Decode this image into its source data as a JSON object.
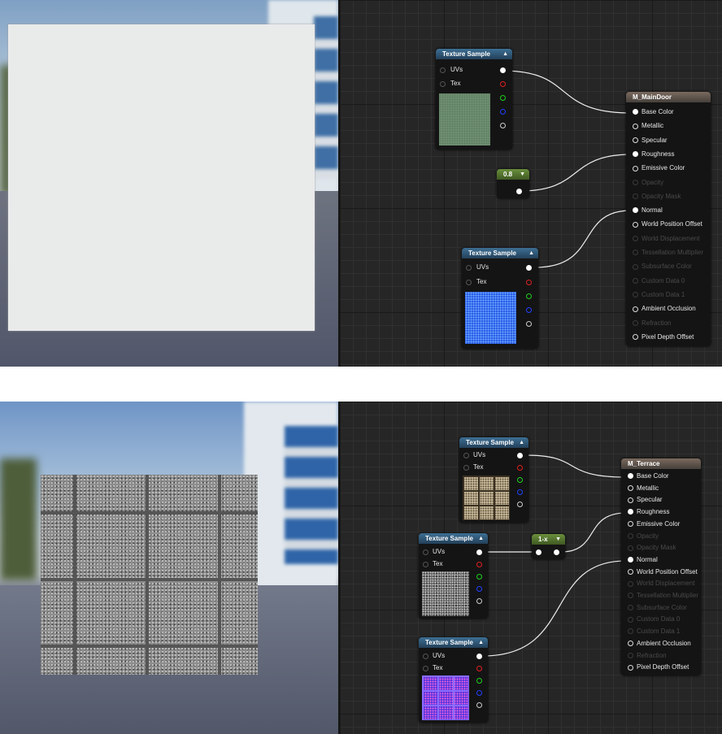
{
  "top": {
    "constant_value": "0.8",
    "material": {
      "title": "M_MainDoor",
      "inputs": [
        {
          "label": "Base Color",
          "enabled": true,
          "connected": true
        },
        {
          "label": "Metallic",
          "enabled": true,
          "connected": false
        },
        {
          "label": "Specular",
          "enabled": true,
          "connected": false
        },
        {
          "label": "Roughness",
          "enabled": true,
          "connected": true
        },
        {
          "label": "Emissive Color",
          "enabled": true,
          "connected": false
        },
        {
          "label": "Opacity",
          "enabled": false,
          "connected": false
        },
        {
          "label": "Opacity Mask",
          "enabled": false,
          "connected": false
        },
        {
          "label": "Normal",
          "enabled": true,
          "connected": true
        },
        {
          "label": "World Position Offset",
          "enabled": true,
          "connected": false
        },
        {
          "label": "World Displacement",
          "enabled": false,
          "connected": false
        },
        {
          "label": "Tessellation Multiplier",
          "enabled": false,
          "connected": false
        },
        {
          "label": "Subsurface Color",
          "enabled": false,
          "connected": false
        },
        {
          "label": "Custom Data 0",
          "enabled": false,
          "connected": false
        },
        {
          "label": "Custom Data 1",
          "enabled": false,
          "connected": false
        },
        {
          "label": "Ambient Occlusion",
          "enabled": true,
          "connected": false
        },
        {
          "label": "Refraction",
          "enabled": false,
          "connected": false
        },
        {
          "label": "Pixel Depth Offset",
          "enabled": true,
          "connected": false
        }
      ]
    },
    "texture_nodes": [
      {
        "title": "Texture Sample",
        "uvs": "UVs",
        "tex": "Tex"
      },
      {
        "title": "Texture Sample",
        "uvs": "UVs",
        "tex": "Tex"
      }
    ]
  },
  "bottom": {
    "oneminus_label": "1-x",
    "material": {
      "title": "M_Terrace",
      "inputs": [
        {
          "label": "Base Color",
          "enabled": true,
          "connected": true
        },
        {
          "label": "Metallic",
          "enabled": true,
          "connected": false
        },
        {
          "label": "Specular",
          "enabled": true,
          "connected": false
        },
        {
          "label": "Roughness",
          "enabled": true,
          "connected": true
        },
        {
          "label": "Emissive Color",
          "enabled": true,
          "connected": false
        },
        {
          "label": "Opacity",
          "enabled": false,
          "connected": false
        },
        {
          "label": "Opacity Mask",
          "enabled": false,
          "connected": false
        },
        {
          "label": "Normal",
          "enabled": true,
          "connected": true
        },
        {
          "label": "World Position Offset",
          "enabled": true,
          "connected": false
        },
        {
          "label": "World Displacement",
          "enabled": false,
          "connected": false
        },
        {
          "label": "Tessellation Multiplier",
          "enabled": false,
          "connected": false
        },
        {
          "label": "Subsurface Color",
          "enabled": false,
          "connected": false
        },
        {
          "label": "Custom Data 0",
          "enabled": false,
          "connected": false
        },
        {
          "label": "Custom Data 1",
          "enabled": false,
          "connected": false
        },
        {
          "label": "Ambient Occlusion",
          "enabled": true,
          "connected": false
        },
        {
          "label": "Refraction",
          "enabled": false,
          "connected": false
        },
        {
          "label": "Pixel Depth Offset",
          "enabled": true,
          "connected": false
        }
      ]
    },
    "texture_nodes": [
      {
        "title": "Texture Sample",
        "uvs": "UVs",
        "tex": "Tex"
      },
      {
        "title": "Texture Sample",
        "uvs": "UVs",
        "tex": "Tex"
      },
      {
        "title": "Texture Sample",
        "uvs": "UVs",
        "tex": "Tex"
      }
    ]
  },
  "colors": {
    "graph_bg": "#262626",
    "texture_header": "#3d6f94",
    "constant_header": "#6a8f3c",
    "material_header": "#7b6a5e",
    "sky": "#9fbad6",
    "floor": "#6f7480"
  },
  "icons": [
    "collapse-arrow-icon",
    "pin-icon"
  ]
}
